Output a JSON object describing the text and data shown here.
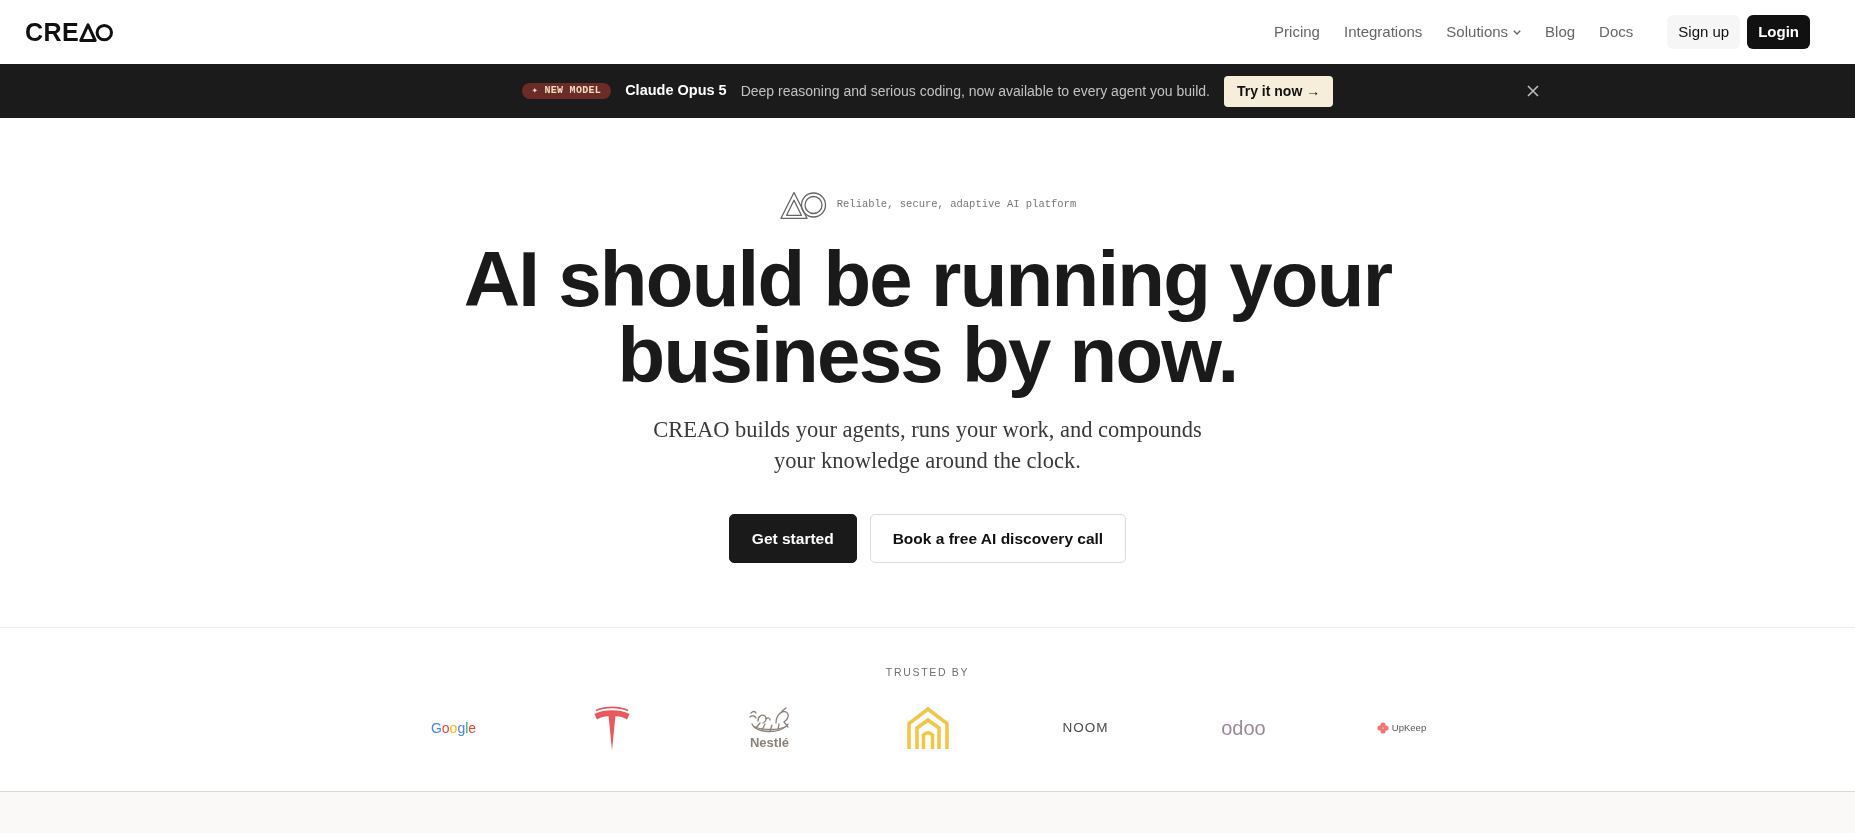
{
  "header": {
    "logo": {
      "text": "CRE"
    },
    "nav": [
      {
        "label": "Pricing",
        "kind": "link"
      },
      {
        "label": "Integrations",
        "kind": "link"
      },
      {
        "label": "Solutions",
        "kind": "dropdown"
      },
      {
        "label": "Blog",
        "kind": "link"
      },
      {
        "label": "Docs",
        "kind": "link"
      }
    ],
    "buttons": [
      {
        "label": "Sign up",
        "kind": "secondary"
      },
      {
        "label": "Login",
        "kind": "primary"
      }
    ]
  },
  "announcement": {
    "badge": "✦ NEW MODEL",
    "title": "Claude Opus 5",
    "text": "Deep reasoning and serious coding, now available to every agent you build.",
    "button": "Try it now →"
  },
  "hero": {
    "tagline": "Reliable, secure, adaptive AI platform",
    "heading": "AI should be running your business by now.",
    "subtitle": "CREAO builds your agents, runs your work, and compounds your knowledge around the clock.",
    "buttons": [
      {
        "label": "Get started",
        "kind": "primary"
      },
      {
        "label": "Book a free AI discovery call",
        "kind": "secondary"
      }
    ]
  },
  "trusted": {
    "title": "TRUSTED BY",
    "logos": [
      {
        "kind": "multicolor",
        "text": "Google"
      },
      {
        "kind": "emblem",
        "color": "#e8595e"
      },
      {
        "kind": "nest",
        "text": "Nestlé",
        "color": "#8c8279"
      },
      {
        "kind": "house",
        "color": "#f6c343"
      },
      {
        "kind": "spaced",
        "text": "NOOM",
        "color": "#4a4a4a"
      },
      {
        "kind": "wordmark",
        "text": "odoo",
        "color": "#9c8898"
      },
      {
        "kind": "flower",
        "text": "UpKeep",
        "color": "#f07575"
      }
    ]
  }
}
